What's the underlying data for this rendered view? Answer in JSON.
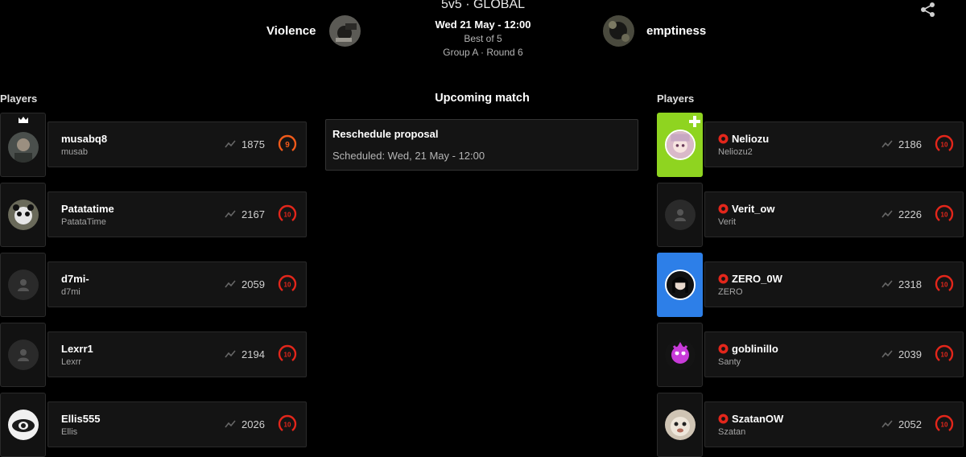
{
  "header": {
    "mode": "5v5 · GLOBAL",
    "team_left": "Violence",
    "team_right": "emptiness",
    "date": "Wed 21 May - 12:00",
    "best_of": "Best of 5",
    "group_round": "Group A · Round 6",
    "share_icon": "share-icon"
  },
  "left_title": "Players",
  "right_title": "Players",
  "upcoming_title": "Upcoming match",
  "reschedule": {
    "title": "Reschedule proposal",
    "scheduled": "Scheduled: Wed, 21 May - 12:00"
  },
  "left_players": [
    {
      "name": "musabq8",
      "sub": "musab",
      "rating": "1875",
      "level": "9",
      "captain": true
    },
    {
      "name": "Patatatime",
      "sub": "PatataTime",
      "rating": "2167",
      "level": "10"
    },
    {
      "name": "d7mi-",
      "sub": "d7mi",
      "rating": "2059",
      "level": "10"
    },
    {
      "name": "Lexrr1",
      "sub": "Lexrr",
      "rating": "2194",
      "level": "10"
    },
    {
      "name": "Ellis555",
      "sub": "Ellis",
      "rating": "2026",
      "level": "10"
    }
  ],
  "right_players": [
    {
      "name": "Neliozu",
      "sub": "Neliozu2",
      "rating": "2186",
      "level": "10"
    },
    {
      "name": "Verit_ow",
      "sub": "Verit",
      "rating": "2226",
      "level": "10"
    },
    {
      "name": "ZERO_0W",
      "sub": "ZERO",
      "rating": "2318",
      "level": "10"
    },
    {
      "name": "goblinillo",
      "sub": "Santy",
      "rating": "2039",
      "level": "10"
    },
    {
      "name": "SzatanOW",
      "sub": "Szatan",
      "rating": "2052",
      "level": "10"
    }
  ],
  "colors": {
    "background": "#000000",
    "card": "#141414",
    "level_ring": "#e3261b",
    "level_9_ring": "#f05a1a"
  }
}
